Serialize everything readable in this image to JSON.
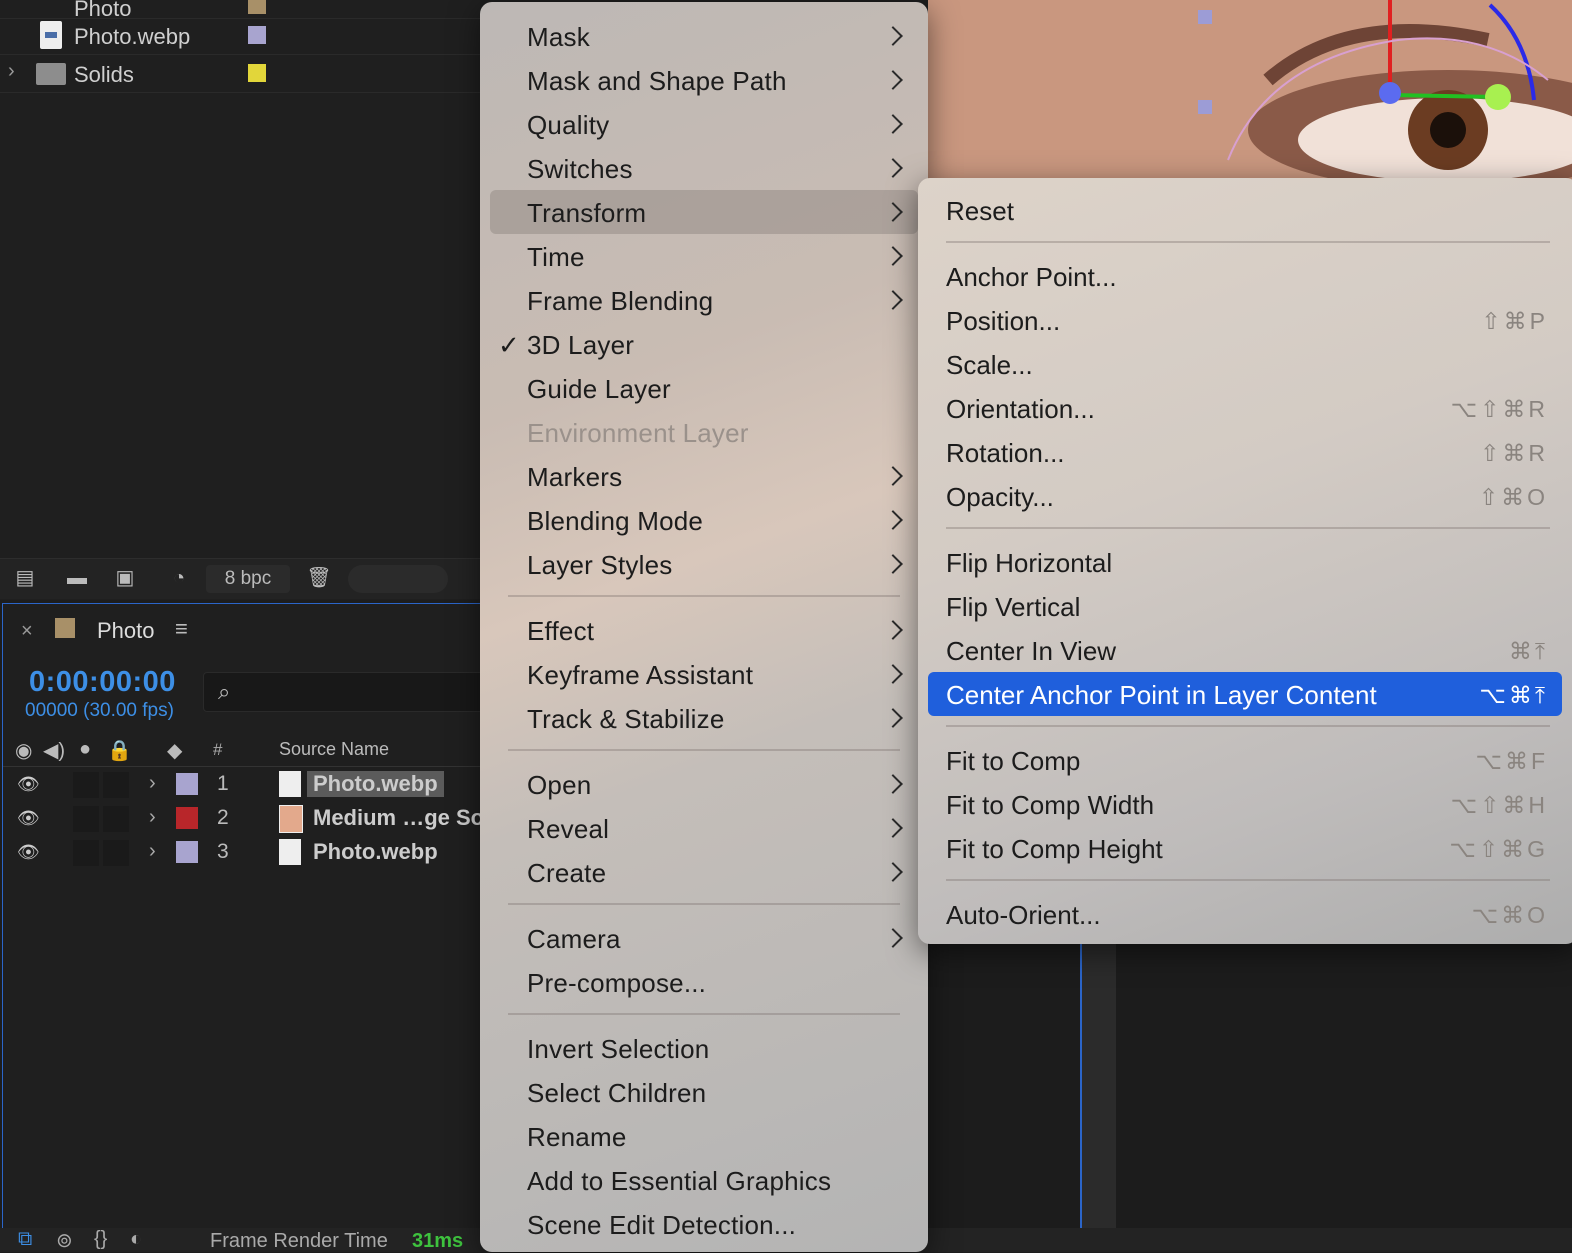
{
  "project": {
    "items": [
      {
        "label": "Photo",
        "color": "#a89068"
      },
      {
        "label": "Photo.webp",
        "color": "#a8a4cf"
      },
      {
        "label": "Solids",
        "color": "#e2d63a"
      }
    ],
    "bpc_label": "8 bpc"
  },
  "timeline": {
    "comp_name": "Photo",
    "timecode": "0:00:00:00",
    "frames": "00000 (30.00 fps)",
    "col_num": "#",
    "col_source": "Source Name",
    "layers": [
      {
        "num": "1",
        "name": "Photo.webp",
        "color": "#a8a4cf"
      },
      {
        "num": "2",
        "name": "Medium …ge Sol",
        "color": "#b8262a"
      },
      {
        "num": "3",
        "name": "Photo.webp",
        "color": "#a8a4cf"
      }
    ],
    "frame_render_label": "Frame Render Time",
    "frame_render_value": "31ms"
  },
  "main_menu": {
    "items": [
      {
        "label": "Mask",
        "submenu": true
      },
      {
        "label": "Mask and Shape Path",
        "submenu": true
      },
      {
        "label": "Quality",
        "submenu": true
      },
      {
        "label": "Switches",
        "submenu": true
      },
      {
        "label": "Transform",
        "submenu": true,
        "highlighted": true
      },
      {
        "label": "Time",
        "submenu": true
      },
      {
        "label": "Frame Blending",
        "submenu": true
      },
      {
        "label": "3D Layer",
        "checked": true
      },
      {
        "label": "Guide Layer"
      },
      {
        "label": "Environment Layer",
        "disabled": true
      },
      {
        "label": "Markers",
        "submenu": true
      },
      {
        "label": "Blending Mode",
        "submenu": true
      },
      {
        "label": "Layer Styles",
        "submenu": true
      },
      {
        "label": "Effect",
        "submenu": true
      },
      {
        "label": "Keyframe Assistant",
        "submenu": true
      },
      {
        "label": "Track & Stabilize",
        "submenu": true
      },
      {
        "label": "Open",
        "submenu": true
      },
      {
        "label": "Reveal",
        "submenu": true
      },
      {
        "label": "Create",
        "submenu": true
      },
      {
        "label": "Camera",
        "submenu": true
      },
      {
        "label": "Pre-compose..."
      },
      {
        "label": "Invert Selection"
      },
      {
        "label": "Select Children"
      },
      {
        "label": "Rename"
      },
      {
        "label": "Add to Essential Graphics"
      },
      {
        "label": "Scene Edit Detection..."
      }
    ]
  },
  "transform_menu": {
    "items": [
      {
        "label": "Reset",
        "shortcut": ""
      },
      {
        "label": "Anchor Point...",
        "shortcut": ""
      },
      {
        "label": "Position...",
        "shortcut": "⇧⌘P"
      },
      {
        "label": "Scale...",
        "shortcut": ""
      },
      {
        "label": "Orientation...",
        "shortcut": "⌥⇧⌘R"
      },
      {
        "label": "Rotation...",
        "shortcut": "⇧⌘R"
      },
      {
        "label": "Opacity...",
        "shortcut": "⇧⌘O"
      },
      {
        "label": "Flip Horizontal",
        "shortcut": ""
      },
      {
        "label": "Flip Vertical",
        "shortcut": ""
      },
      {
        "label": "Center In View",
        "shortcut": "⌘⤒"
      },
      {
        "label": "Center Anchor Point in Layer Content",
        "shortcut": "⌥⌘⤒",
        "selected": true
      },
      {
        "label": "Fit to Comp",
        "shortcut": "⌥⌘F"
      },
      {
        "label": "Fit to Comp Width",
        "shortcut": "⌥⇧⌘H"
      },
      {
        "label": "Fit to Comp Height",
        "shortcut": "⌥⇧⌘G"
      },
      {
        "label": "Auto-Orient...",
        "shortcut": "⌥⌘O"
      }
    ]
  }
}
